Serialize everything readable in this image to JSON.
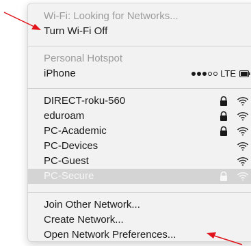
{
  "wifi_menu": {
    "status": "Wi-Fi: Looking for Networks...",
    "toggle_label": "Turn Wi-Fi Off",
    "hotspot_header": "Personal Hotspot",
    "hotspot_device": "iPhone",
    "hotspot_signal_bars": 3,
    "hotspot_signal_max": 5,
    "hotspot_network_type": "LTE",
    "networks": [
      {
        "name": "DIRECT-roku-560",
        "locked": true,
        "selected": false
      },
      {
        "name": "eduroam",
        "locked": true,
        "selected": false
      },
      {
        "name": "PC-Academic",
        "locked": true,
        "selected": false
      },
      {
        "name": "PC-Devices",
        "locked": false,
        "selected": false
      },
      {
        "name": "PC-Guest",
        "locked": false,
        "selected": false
      },
      {
        "name": "PC-Secure",
        "locked": true,
        "selected": true
      }
    ],
    "join_other": "Join Other Network...",
    "create_network": "Create Network...",
    "open_prefs": "Open Network Preferences..."
  },
  "annotations": {
    "arrow_color": "#e0141a"
  }
}
